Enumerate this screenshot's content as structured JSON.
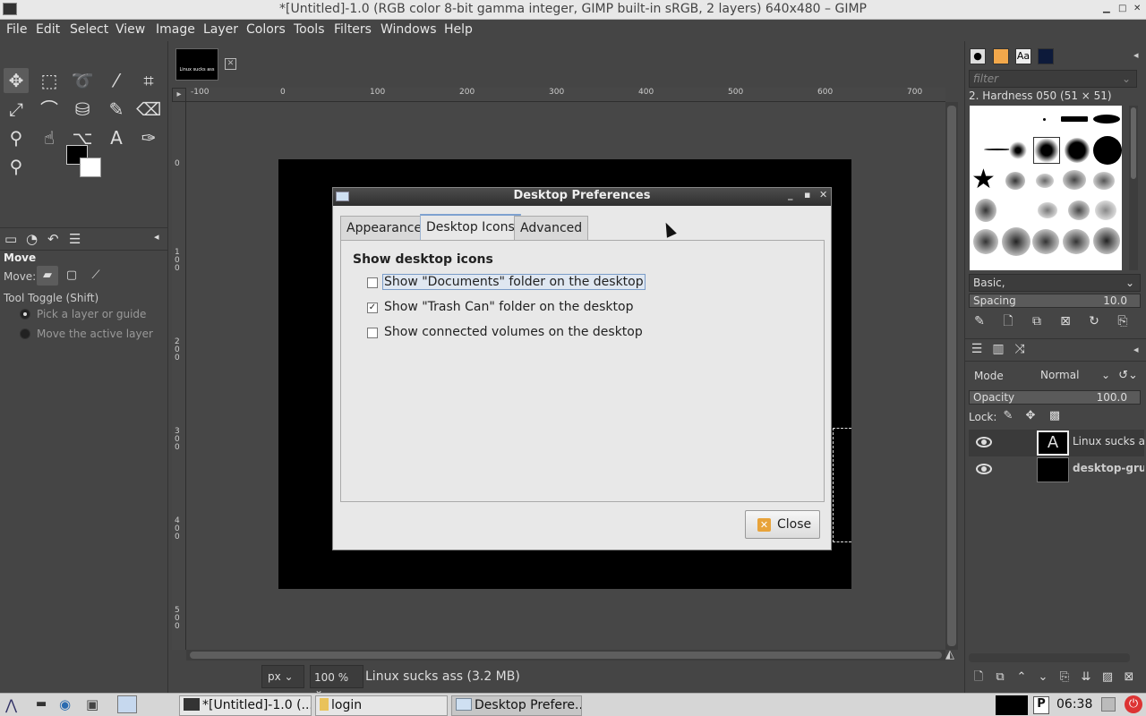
{
  "window": {
    "title": "*[Untitled]-1.0 (RGB color 8-bit gamma integer, GIMP built-in sRGB, 2 layers) 640x480 – GIMP"
  },
  "menubar": [
    "File",
    "Edit",
    "Select",
    "View",
    "Image",
    "Layer",
    "Colors",
    "Tools",
    "Filters",
    "Windows",
    "Help"
  ],
  "image_tab": {
    "thumb_text": "Linux sucks ass"
  },
  "ruler": {
    "h_labels": [
      "-100",
      "0",
      "100",
      "200",
      "300",
      "400",
      "500",
      "600",
      "700"
    ],
    "v_labels": [
      "0",
      "100",
      "200",
      "300",
      "400",
      "500"
    ]
  },
  "tool_options": {
    "title": "Move",
    "move_label": "Move:",
    "toggle_label": "Tool Toggle  (Shift)",
    "option1": "Pick a layer or guide",
    "option2": "Move the active layer"
  },
  "statusbar": {
    "unit": "px",
    "zoom": "100 %",
    "message": "Linux sucks ass (3.2 MB)"
  },
  "dialog": {
    "title": "Desktop Preferences",
    "tabs": [
      "Appearance",
      "Desktop Icons",
      "Advanced"
    ],
    "active_tab": "Desktop Icons",
    "section_title": "Show desktop icons",
    "options": [
      {
        "label": "Show \"Documents\" folder on the desktop",
        "checked": false
      },
      {
        "label": "Show \"Trash Can\" folder on the desktop",
        "checked": true
      },
      {
        "label": "Show connected volumes on the desktop",
        "checked": false
      }
    ],
    "close_label": "Close"
  },
  "brushes": {
    "filter_placeholder": "filter",
    "selected": "2. Hardness 050 (51 × 51)",
    "tag": "Basic,",
    "spacing_label": "Spacing",
    "spacing_value": "10.0"
  },
  "layers": {
    "mode_label": "Mode",
    "mode_value": "Normal",
    "opacity_label": "Opacity",
    "opacity_value": "100.0",
    "lock_label": "Lock:",
    "items": [
      {
        "name": "Linux sucks ass"
      },
      {
        "name": "desktop-gru"
      }
    ]
  },
  "taskbar": {
    "tasks": [
      "*[Untitled]-1.0 (...",
      "login",
      "Desktop Prefere..."
    ],
    "clock": "06:38"
  },
  "colors": {
    "accent": "#7ea1cf",
    "canvas": "#000000",
    "ui_bg": "#454545"
  }
}
